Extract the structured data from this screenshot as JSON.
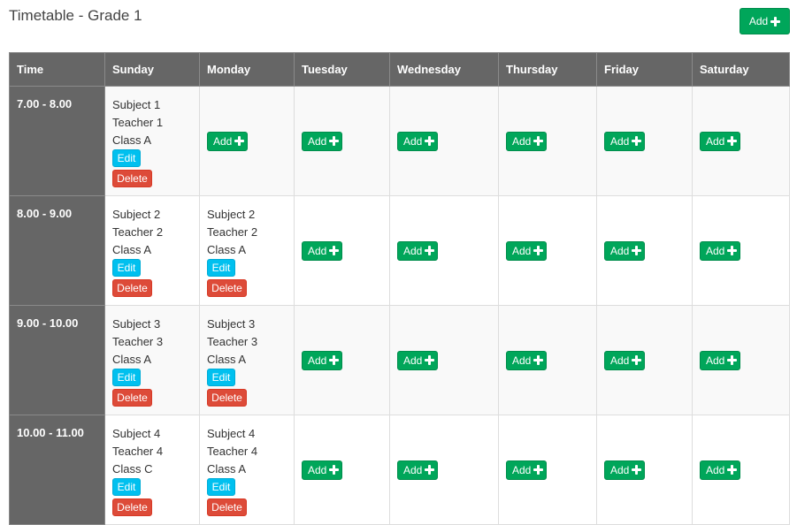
{
  "page": {
    "title": "Timetable - Grade 1",
    "add_label": "Add"
  },
  "table": {
    "headers": [
      "Time",
      "Sunday",
      "Monday",
      "Tuesday",
      "Wednesday",
      "Thursday",
      "Friday",
      "Saturday"
    ],
    "rows": [
      {
        "time": "7.00 - 8.00",
        "cells": [
          {
            "subject": "Subject 1",
            "teacher": "Teacher 1",
            "class": "Class A"
          },
          null,
          null,
          null,
          null,
          null,
          null
        ]
      },
      {
        "time": "8.00 - 9.00",
        "cells": [
          {
            "subject": "Subject 2",
            "teacher": "Teacher 2",
            "class": "Class A"
          },
          {
            "subject": "Subject 2",
            "teacher": "Teacher 2",
            "class": "Class A"
          },
          null,
          null,
          null,
          null,
          null
        ]
      },
      {
        "time": "9.00 - 10.00",
        "cells": [
          {
            "subject": "Subject 3",
            "teacher": "Teacher 3",
            "class": "Class A"
          },
          {
            "subject": "Subject 3",
            "teacher": "Teacher 3",
            "class": "Class A"
          },
          null,
          null,
          null,
          null,
          null
        ]
      },
      {
        "time": "10.00 - 11.00",
        "cells": [
          {
            "subject": "Subject 4",
            "teacher": "Teacher 4",
            "class": "Class C"
          },
          {
            "subject": "Subject 4",
            "teacher": "Teacher 4",
            "class": "Class A"
          },
          null,
          null,
          null,
          null,
          null
        ]
      }
    ]
  },
  "labels": {
    "add": "Add",
    "edit": "Edit",
    "delete": "Delete"
  },
  "colors": {
    "add": "#00a65a",
    "edit": "#00c0ef",
    "delete": "#dd4b39",
    "header": "#666666"
  },
  "icons": {
    "add": "plus-icon"
  }
}
